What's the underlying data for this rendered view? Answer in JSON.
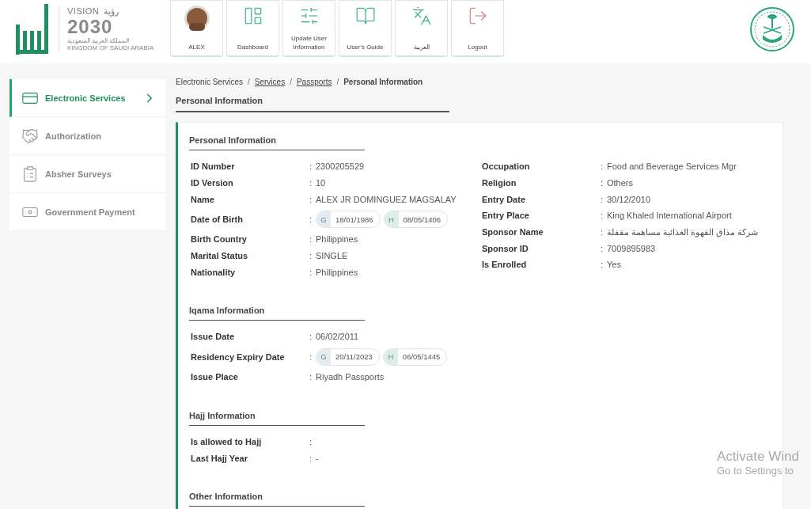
{
  "header": {
    "vision_logo": {
      "word": "VISION",
      "arabic_word": "رؤية",
      "year": "2030",
      "arabic_country": "المملكة العربية السعودية",
      "country": "KINGDOM OF SAUDI ARABIA"
    },
    "nav_buttons": [
      {
        "kind": "avatar",
        "label": "ALEX"
      },
      {
        "kind": "dashboard",
        "label": "Dashboard"
      },
      {
        "kind": "update",
        "label": "Update User Information"
      },
      {
        "kind": "guide",
        "label": "User's Guide"
      },
      {
        "kind": "language",
        "label": "العربية"
      },
      {
        "kind": "logout",
        "label": "Logout"
      }
    ]
  },
  "sidebar": {
    "items": [
      {
        "kind": "services",
        "label": "Electronic Services",
        "selected": true
      },
      {
        "kind": "authorization",
        "label": "Authorization",
        "selected": false
      },
      {
        "kind": "surveys",
        "label": "Absher Surveys",
        "selected": false
      },
      {
        "kind": "payment",
        "label": "Government Payment",
        "selected": false
      }
    ]
  },
  "breadcrumb": [
    {
      "label": "Electronic Services",
      "link": false
    },
    {
      "separator": "/",
      "label": "Services",
      "link": true
    },
    {
      "separator": "/",
      "label": "Passports",
      "link": true
    },
    {
      "separator": "/",
      "label": "Personal Information",
      "link": false
    }
  ],
  "page_title": "Personal Information",
  "sections": [
    {
      "title": "Personal Information",
      "left": [
        {
          "label": "ID Number",
          "colon": ":",
          "value": "2300205529"
        },
        {
          "label": "ID Version",
          "colon": ":",
          "value": "10"
        },
        {
          "label": "Name",
          "colon": ":",
          "value": "ALEX JR DOMINGUEZ MAGSALAY"
        },
        {
          "label": "Date of Birth",
          "colon": ":",
          "dates": [
            {
              "calendar": "G",
              "value": "18/01/1986"
            },
            {
              "calendar": "H",
              "value": "08/05/1406"
            }
          ]
        },
        {
          "label": "Birth Country",
          "colon": ":",
          "value": "Philippines"
        },
        {
          "label": "Marital Status",
          "colon": ":",
          "value": "SINGLE"
        },
        {
          "label": "Nationality",
          "colon": ":",
          "value": "Philippines"
        }
      ],
      "right": [
        {
          "label": "Occupation",
          "colon": ":",
          "value": "Food and Beverage Services Mgr"
        },
        {
          "label": "Religion",
          "colon": ":",
          "value": "Others"
        },
        {
          "label": "Entry Date",
          "colon": ":",
          "value": "30/12/2010"
        },
        {
          "label": "Entry Place",
          "colon": ":",
          "value": "King Khaled International Airport"
        },
        {
          "label": "Sponsor Name",
          "colon": ":",
          "value": "شركة مذاق القهوة الغذائية مساهمة مقفلة"
        },
        {
          "label": "Sponsor ID",
          "colon": ":",
          "value": "7009895983"
        },
        {
          "label": "Is Enrolled",
          "colon": ":",
          "value": "Yes"
        }
      ]
    },
    {
      "title": "Iqama Information",
      "left": [
        {
          "label": "Issue Date",
          "colon": ":",
          "value": "06/02/2011"
        },
        {
          "label": "Residency Expiry Date",
          "colon": ":",
          "dates": [
            {
              "calendar": "G",
              "value": "20/11/2023"
            },
            {
              "calendar": "H",
              "value": "06/05/1445"
            }
          ]
        },
        {
          "label": "Issue Place",
          "colon": ":",
          "value": "Riyadh Passports"
        }
      ]
    },
    {
      "title": "Hajj Information",
      "left": [
        {
          "label": "Is allowed to Hajj",
          "colon": ":"
        },
        {
          "label": "Last Hajj Year",
          "colon": ":",
          "value": "-"
        }
      ]
    },
    {
      "title": "Other Information"
    }
  ],
  "os_overlay": [
    "Activate Wind",
    "Go to Settings to"
  ]
}
